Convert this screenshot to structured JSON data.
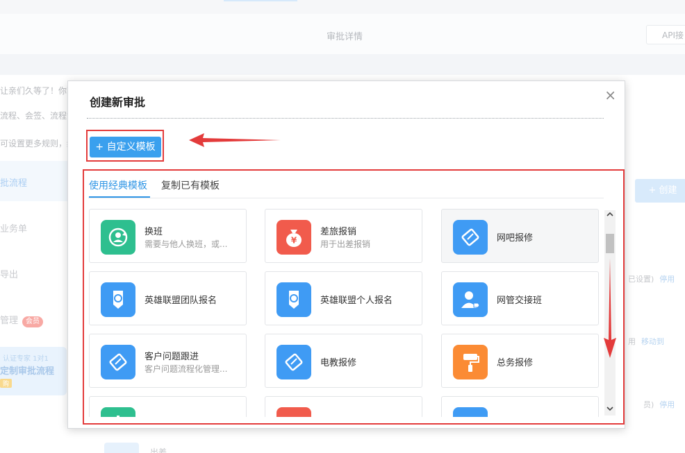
{
  "background": {
    "tab_title": "审批详情",
    "api_button": "API接",
    "notes": [
      "让亲们久等了！你可",
      "流程、会签、流程协",
      "可设置更多规则，结"
    ],
    "sidebar": [
      {
        "label": "批流程",
        "active": true
      },
      {
        "label": "业务单",
        "active": false
      },
      {
        "label": "导出",
        "active": false
      },
      {
        "label": "管理",
        "active": false,
        "badge": "会员"
      }
    ],
    "promo": {
      "line1": "认证专家 1对1",
      "line2": "定制审批流程",
      "tag": "购"
    },
    "create_button": "+ 创建",
    "right_texts": [
      {
        "text": "已设置)",
        "link": "停用"
      },
      {
        "text": "用",
        "link": "移动到"
      },
      {
        "text": "员)",
        "link": "停用"
      }
    ],
    "bottom_row_label": "出差"
  },
  "modal": {
    "title": "创建新审批",
    "close": "×",
    "custom_template_button": "+ 自定义模板",
    "tabs": [
      {
        "label": "使用经典模板",
        "active": true
      },
      {
        "label": "复制已有模板",
        "active": false
      }
    ],
    "templates": [
      {
        "title": "换班",
        "desc": "需要与他人换班，或...",
        "icon": "refresh-person-icon",
        "color": "#2ebf8f"
      },
      {
        "title": "差旅报销",
        "desc": "用于出差报销",
        "icon": "money-bag-icon",
        "color": "#f15b4c"
      },
      {
        "title": "网吧报修",
        "desc": "",
        "icon": "wrench-tag-icon",
        "color": "#3f9bf4"
      },
      {
        "title": "英雄联盟团队报名",
        "desc": "",
        "icon": "award-ribbon-icon",
        "color": "#3f9bf4"
      },
      {
        "title": "英雄联盟个人报名",
        "desc": "",
        "icon": "award-ribbon-icon",
        "color": "#3f9bf4"
      },
      {
        "title": "网管交接班",
        "desc": "",
        "icon": "person-tag-icon",
        "color": "#3f9bf4"
      },
      {
        "title": "客户问题跟进",
        "desc": "客户问题流程化管理...",
        "icon": "wrench-tag-icon",
        "color": "#3f9bf4"
      },
      {
        "title": "电教报修",
        "desc": "",
        "icon": "wrench-tag-icon",
        "color": "#3f9bf4"
      },
      {
        "title": "总务报修",
        "desc": "",
        "icon": "paint-roller-icon",
        "color": "#fb8b34"
      },
      {
        "title": "",
        "desc": "",
        "icon": "person-icon",
        "color": "#2ebf8f"
      },
      {
        "title": "",
        "desc": "",
        "icon": "document-icon",
        "color": "#f15b4c"
      },
      {
        "title": "",
        "desc": "",
        "icon": "group-icon",
        "color": "#3f9bf4"
      }
    ],
    "scrollbar": {
      "up": "^",
      "down": "v"
    }
  },
  "colors": {
    "accent": "#2f95e5",
    "annotation_red": "#e33b3b"
  }
}
